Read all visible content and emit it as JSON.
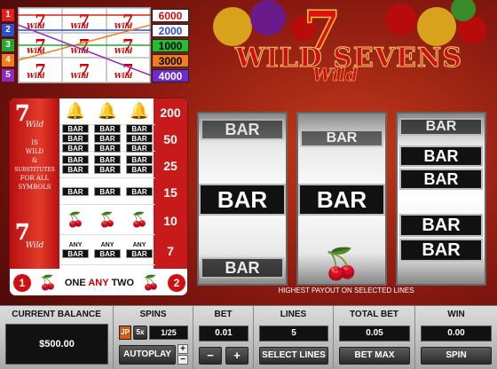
{
  "paylines": [
    {
      "num": "1",
      "payout": "6000",
      "color": "#e0201a",
      "payout_bg": "#ffffff",
      "payout_color": "#d01010"
    },
    {
      "num": "2",
      "payout": "2000",
      "color": "#2a4fd0",
      "payout_bg": "#ffffff",
      "payout_color": "#2a4fd0"
    },
    {
      "num": "3",
      "payout": "1000",
      "color": "#24a832",
      "payout_bg": "#22c02c",
      "payout_color": "#000000"
    },
    {
      "num": "4",
      "payout": "3000",
      "color": "#f07d1c",
      "payout_bg": "#f07d1c",
      "payout_color": "#000000"
    },
    {
      "num": "5",
      "payout": "4000",
      "color": "#8e2bbf",
      "payout_bg": "#6b2bd0",
      "payout_color": "#ffffff"
    }
  ],
  "mini_reels": [
    "7",
    "7",
    "7",
    "7",
    "7",
    "7",
    "7",
    "7",
    "7"
  ],
  "mini_wild": "Wild",
  "logo": {
    "seven": "7",
    "title": "WILD SEVENS",
    "wild": "Wild"
  },
  "paytable": {
    "wild_seven": "7",
    "wild_word": "Wild",
    "wild_text": [
      "IS",
      "WILD",
      "&",
      "SUBSTITUTES",
      "FOR ALL",
      "SYMBOLS"
    ],
    "values": [
      "200",
      "50",
      "25",
      "15",
      "10",
      "7"
    ],
    "bar": "BAR",
    "any": "ANY",
    "bottom": {
      "left_num": "1",
      "right_num": "2",
      "one": "ONE",
      "any": "ANY",
      "two": "TWO"
    }
  },
  "reels": {
    "bar": "BAR"
  },
  "highest_payout": "HIGHEST PAYOUT ON SELECTED LINES",
  "controls": {
    "balance": {
      "label": "CURRENT BALANCE",
      "value": "$500.00"
    },
    "spins": {
      "label": "SPINS",
      "jp": "JP",
      "multiplier": "5x",
      "count": "1/25",
      "autoplay": "AUTOPLAY",
      "plus": "+",
      "minus": "−"
    },
    "bet": {
      "label": "BET",
      "value": "0.01",
      "minus": "−",
      "plus": "+"
    },
    "lines": {
      "label": "LINES",
      "value": "5",
      "select": "SELECT LINES"
    },
    "total_bet": {
      "label": "TOTAL BET",
      "value": "0.05",
      "bet_max": "BET MAX"
    },
    "win": {
      "label": "WIN",
      "value": "0.00",
      "spin": "SPIN"
    }
  }
}
